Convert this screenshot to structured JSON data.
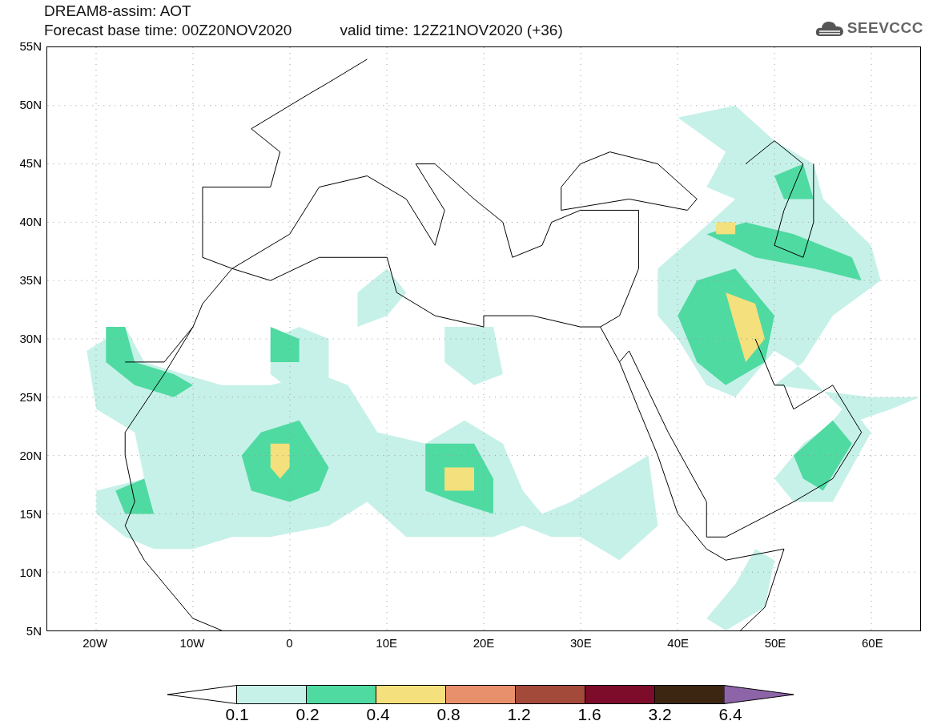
{
  "title": {
    "line1": "DREAM8-assim: AOT",
    "base_time": "Forecast base time: 00Z20NOV2020",
    "valid_time": "valid time: 12Z21NOV2020 (+36)"
  },
  "logo": {
    "text": "SEEVCCC"
  },
  "map": {
    "lat_labels": [
      "55N",
      "50N",
      "45N",
      "40N",
      "35N",
      "30N",
      "25N",
      "20N",
      "15N",
      "10N",
      "5N"
    ],
    "lon_labels": [
      "20W",
      "10W",
      "0",
      "10E",
      "20E",
      "30E",
      "40E",
      "50E",
      "60E"
    ]
  },
  "colorbar": {
    "bins": [
      {
        "color": "#ffffff"
      },
      {
        "color": "#c6f1e8"
      },
      {
        "color": "#4fdaa2"
      },
      {
        "color": "#f4e07c"
      },
      {
        "color": "#e8906c"
      },
      {
        "color": "#a44a3a"
      },
      {
        "color": "#7c0c2a"
      },
      {
        "color": "#3c2612"
      },
      {
        "color": "#8e64a8"
      }
    ],
    "labels": [
      "0.1",
      "0.2",
      "0.4",
      "0.8",
      "1.2",
      "1.6",
      "3.2",
      "6.4"
    ]
  }
}
